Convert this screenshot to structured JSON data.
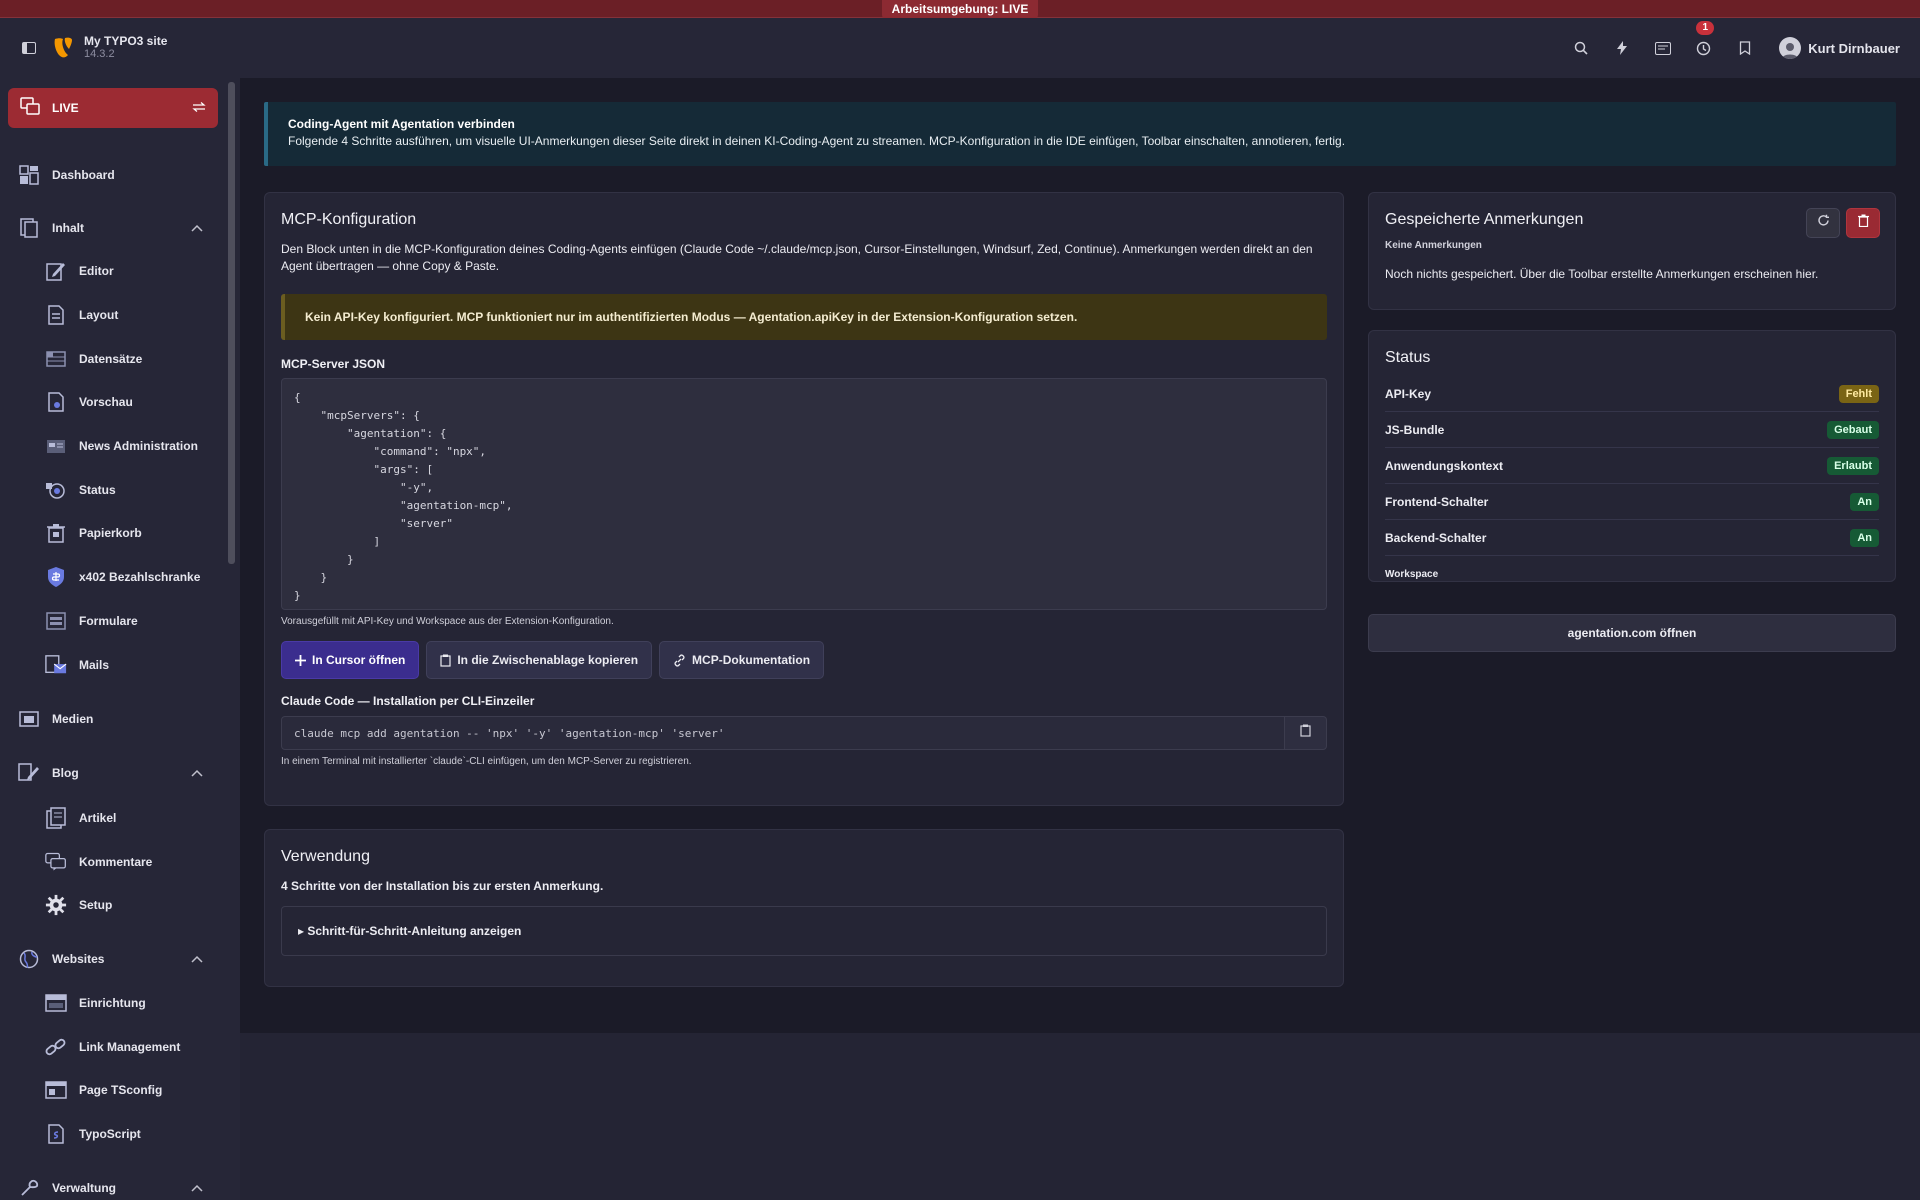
{
  "env_bar": "Arbeitsumgebung: LIVE",
  "topbar": {
    "site_name": "My TYPO3 site",
    "site_version": "14.3.2",
    "notification_count": "1",
    "user_name": "Kurt Dirnbauer"
  },
  "sidebar": {
    "workspace_label": "LIVE",
    "items": [
      {
        "label": "Dashboard"
      },
      {
        "label": "Inhalt"
      },
      {
        "label": "Editor"
      },
      {
        "label": "Layout"
      },
      {
        "label": "Datensätze"
      },
      {
        "label": "Vorschau"
      },
      {
        "label": "News Administration"
      },
      {
        "label": "Status"
      },
      {
        "label": "Papierkorb"
      },
      {
        "label": "x402 Bezahlschranke"
      },
      {
        "label": "Formulare"
      },
      {
        "label": "Mails"
      },
      {
        "label": "Medien"
      },
      {
        "label": "Blog"
      },
      {
        "label": "Artikel"
      },
      {
        "label": "Kommentare"
      },
      {
        "label": "Setup"
      },
      {
        "label": "Websites"
      },
      {
        "label": "Einrichtung"
      },
      {
        "label": "Link Management"
      },
      {
        "label": "Page TSconfig"
      },
      {
        "label": "TypoScript"
      },
      {
        "label": "Verwaltung"
      }
    ]
  },
  "notice": {
    "title": "Coding-Agent mit Agentation verbinden",
    "text": "Folgende 4 Schritte ausführen, um visuelle UI-Anmerkungen dieser Seite direkt in deinen KI-Coding-Agent zu streamen. MCP-Konfiguration in die IDE einfügen, Toolbar einschalten, annotieren, fertig."
  },
  "mcp": {
    "title": "MCP-Konfiguration",
    "description": "Den Block unten in die MCP-Konfiguration deines Coding-Agents einfügen (Claude Code ~/.claude/mcp.json, Cursor-Einstellungen, Windsurf, Zed, Continue). Anmerkungen werden direkt an den Agent übertragen — ohne Copy & Paste.",
    "warning": "Kein API-Key konfiguriert. MCP funktioniert nur im authentifizierten Modus — Agentation.apiKey in der Extension-Konfiguration setzen.",
    "json_label": "MCP-Server JSON",
    "json": "{\n    \"mcpServers\": {\n        \"agentation\": {\n            \"command\": \"npx\",\n            \"args\": [\n                \"-y\",\n                \"agentation-mcp\",\n                \"server\"\n            ]\n        }\n    }\n}",
    "json_hint": "Vorausgefüllt mit API-Key und Workspace aus der Extension-Konfiguration.",
    "btn_cursor": "In Cursor öffnen",
    "btn_copy": "In die Zwischenablage kopieren",
    "btn_docs": "MCP-Dokumentation",
    "cli_label": "Claude Code — Installation per CLI-Einzeiler",
    "cli_command": "claude mcp add agentation -- 'npx' '-y' 'agentation-mcp' 'server'",
    "cli_hint": "In einem Terminal mit installierter `claude`-CLI einfügen, um den MCP-Server zu registrieren."
  },
  "usage": {
    "title": "Verwendung",
    "description": "4 Schritte von der Installation bis zur ersten Anmerkung.",
    "details_toggle": "▸ Schritt-für-Schritt-Anleitung anzeigen"
  },
  "saved": {
    "title": "Gespeicherte Anmerkungen",
    "count_label": "Keine Anmerkungen",
    "empty_text": "Noch nichts gespeichert. Über die Toolbar erstellte Anmerkungen erscheinen hier."
  },
  "status": {
    "title": "Status",
    "rows": [
      {
        "key": "API-Key",
        "value": "Fehlt",
        "state": "warning"
      },
      {
        "key": "JS-Bundle",
        "value": "Gebaut",
        "state": "ok"
      },
      {
        "key": "Anwendungskontext",
        "value": "Erlaubt",
        "state": "ok"
      },
      {
        "key": "Frontend-Schalter",
        "value": "An",
        "state": "ok"
      },
      {
        "key": "Backend-Schalter",
        "value": "An",
        "state": "ok"
      },
      {
        "key": "Workspace",
        "value": "",
        "state": "none"
      }
    ]
  },
  "open_button": "agentation.com öffnen",
  "colors": {
    "live_red": "#9c2b33",
    "primary_purple": "#3b2d8e",
    "ok_green": "#165a35",
    "warn_yellow": "#7a6414",
    "notice_teal": "#152a37"
  }
}
